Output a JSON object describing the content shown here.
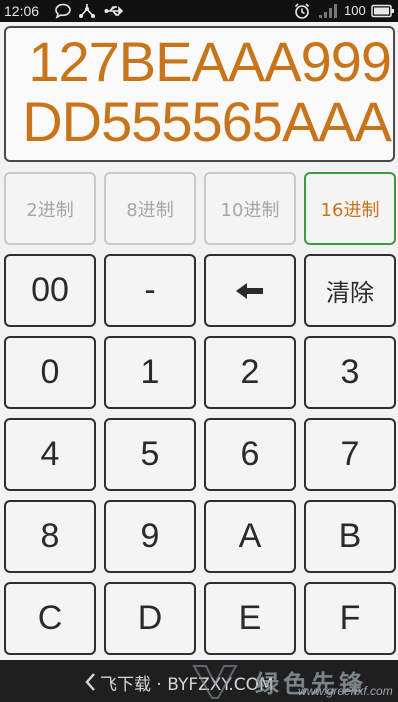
{
  "status_bar": {
    "time": "12:06",
    "icons": [
      "chat-bubble-icon",
      "share-icon",
      "usb-icon",
      "alarm-icon",
      "signal-icon",
      "battery-icon"
    ],
    "battery_text": "100"
  },
  "display": {
    "value": "127BEAAA999DD555565AAA",
    "color": "#c8741b"
  },
  "bases": [
    {
      "label": "2进制",
      "active": false
    },
    {
      "label": "8进制",
      "active": false
    },
    {
      "label": "10进制",
      "active": false
    },
    {
      "label": "16进制",
      "active": true
    }
  ],
  "keys": {
    "double_zero": "00",
    "minus": "-",
    "backspace": "←",
    "clear": "清除",
    "k0": "0",
    "k1": "1",
    "k2": "2",
    "k3": "3",
    "k4": "4",
    "k5": "5",
    "k6": "6",
    "k7": "7",
    "k8": "8",
    "k9": "9",
    "kA": "A",
    "kB": "B",
    "kC": "C",
    "kD": "D",
    "kE": "E",
    "kF": "F"
  },
  "watermark": {
    "text": "飞下载 · BYFZXY.COM",
    "logo_text": "绿色先锋",
    "url": "www.greenxf.com"
  },
  "colors": {
    "accent": "#c8741b",
    "active_border": "#3e9a3e",
    "inactive_text": "#a6a6a6"
  }
}
